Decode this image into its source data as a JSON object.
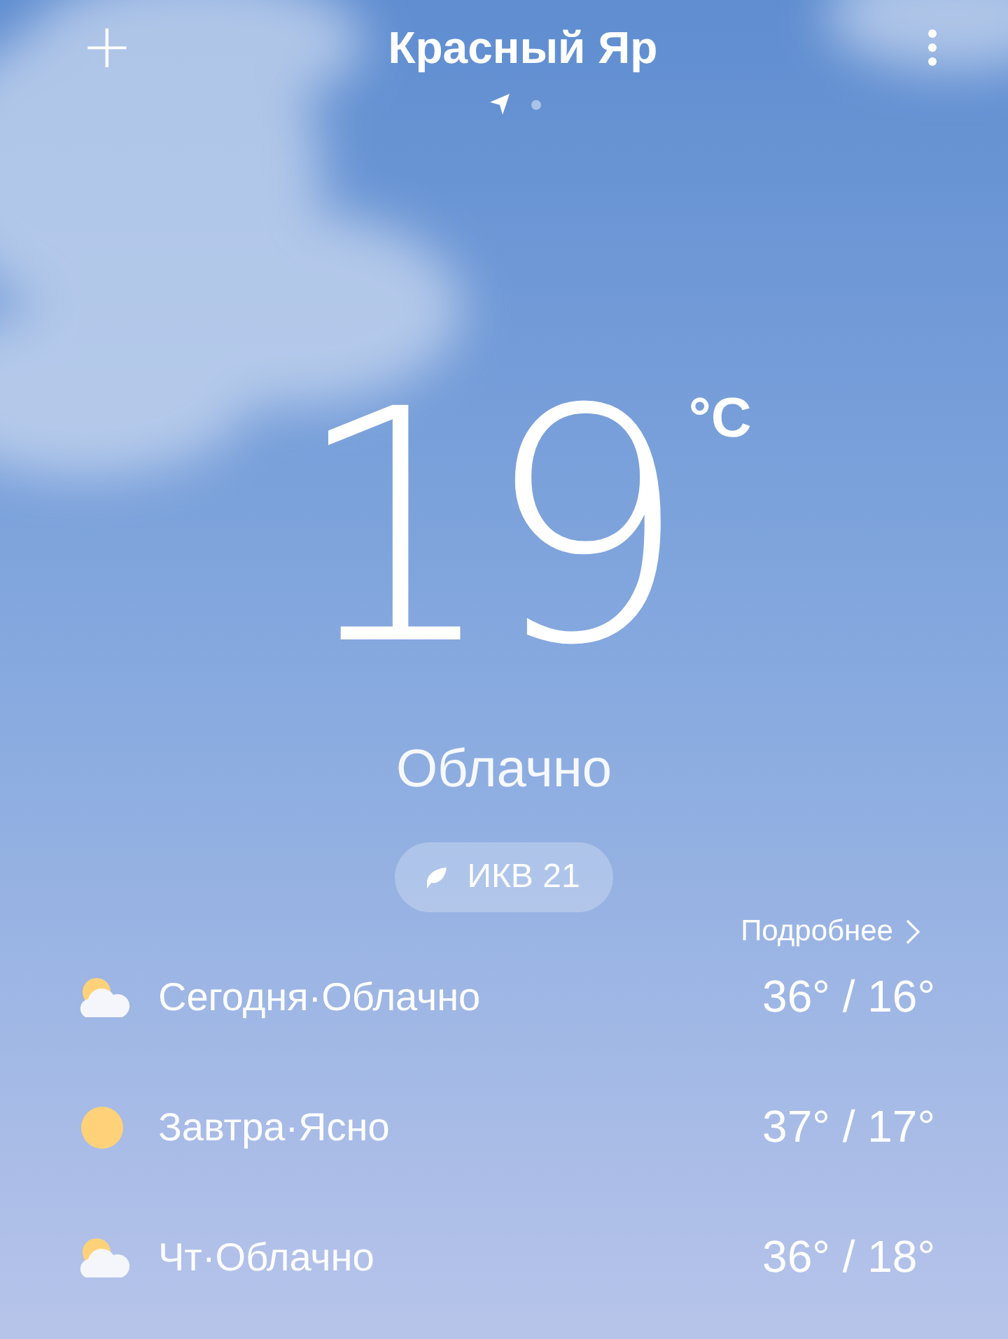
{
  "header": {
    "add_button": "+",
    "city": "Красный Яр",
    "pages": [
      {
        "kind": "location",
        "selected": true
      },
      {
        "kind": "dot",
        "selected": false
      }
    ]
  },
  "current": {
    "temperature": "19",
    "unit": "°C",
    "condition": "Облачно",
    "aqi": "ИКВ 21"
  },
  "details_link": "Подробнее",
  "forecast": [
    {
      "kind": "cloudy",
      "label": "Сегодня·Облачно",
      "temps": "36° / 16°"
    },
    {
      "kind": "sunny",
      "label": "Завтра·Ясно",
      "temps": "37° / 17°"
    },
    {
      "kind": "cloudy",
      "label": "Чт·Облачно",
      "temps": "36° / 18°"
    }
  ]
}
